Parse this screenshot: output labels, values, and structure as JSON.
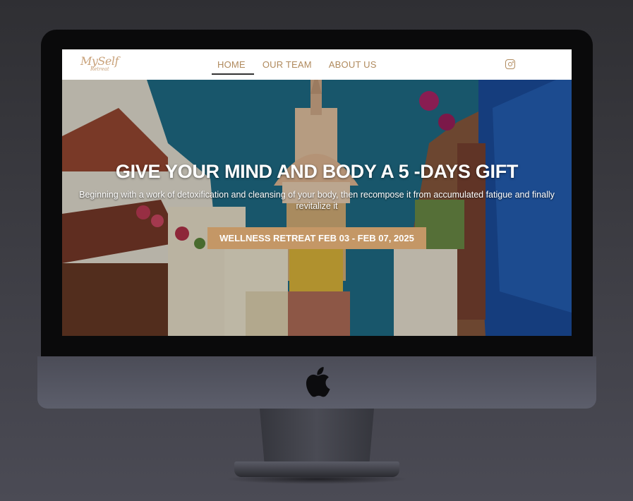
{
  "nav": {
    "logo_line1": "MySelf",
    "logo_line2": "Retreat",
    "links": [
      {
        "label": "HOME",
        "active": true
      },
      {
        "label": "OUR TEAM",
        "active": false
      },
      {
        "label": "ABOUT US",
        "active": false
      }
    ],
    "social_icon": "instagram-icon"
  },
  "hero": {
    "title": "GIVE YOUR MIND AND BODY A 5 -DAYS GIFT",
    "subtitle": "Beginning with a work of detoxification and cleansing of your body, then recompose it from accumulated fatigue and finally revitalize it",
    "cta_label": "WELLNESS RETREAT FEB 03 - FEB 07, 2025"
  },
  "colors": {
    "accent": "#c49766",
    "nav_text": "#b08a5d",
    "nav_bg": "#ffffff"
  },
  "device": {
    "logo_icon": "apple-icon"
  }
}
